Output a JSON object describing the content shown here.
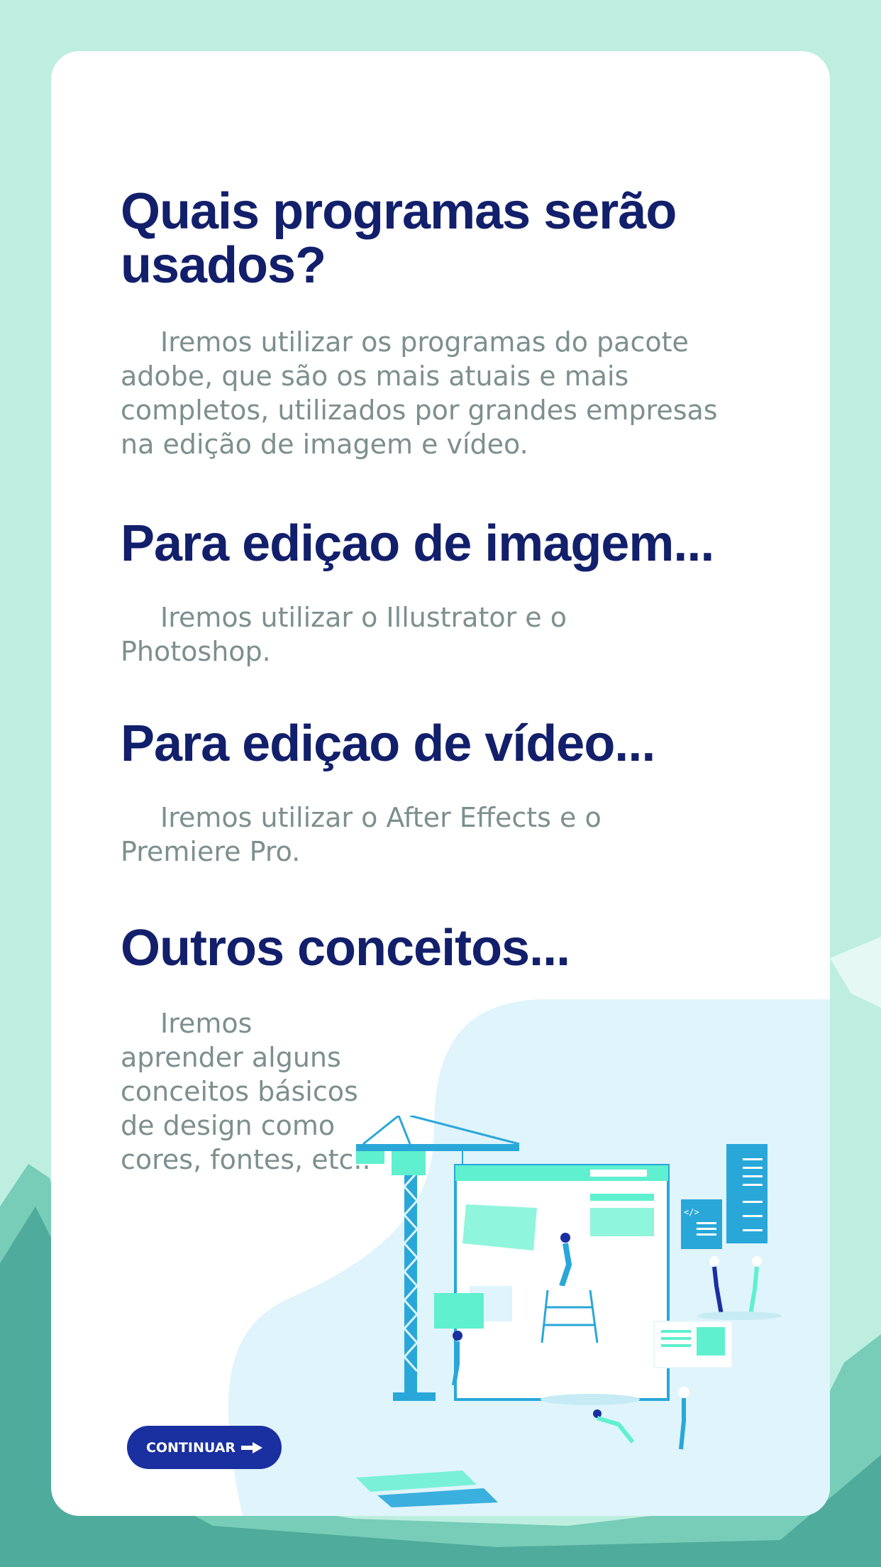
{
  "colors": {
    "background": "#bdeee0",
    "card": "#ffffff",
    "title": "#121f6b",
    "body_text": "#7d8f8f",
    "button": "#1a2fa0",
    "accent_teal": "#5ff0cf",
    "accent_blue": "#29a7d9",
    "blob": "#dff4fb"
  },
  "sections": [
    {
      "title": "Quais programas serão usados?",
      "text": "Iremos utilizar os programas do pacote adobe, que são os mais atuais e mais completos, utilizados por grandes empresas na edição de imagem e vídeo."
    },
    {
      "title": "Para ediçao de imagem...",
      "text": "Iremos utilizar o Illustrator e o Photoshop."
    },
    {
      "title": "Para ediçao de vídeo...",
      "text": "Iremos utilizar o After Effects e o Premiere Pro."
    },
    {
      "title": "Outros conceitos...",
      "text": "Iremos aprender alguns conceitos básicos de design como cores, fontes, etc.."
    }
  ],
  "button": {
    "label": "CONTINUAR",
    "icon": "arrow-right-icon"
  },
  "illustration": {
    "icon": "web-construction-illustration",
    "code_panel_text": "</>"
  }
}
